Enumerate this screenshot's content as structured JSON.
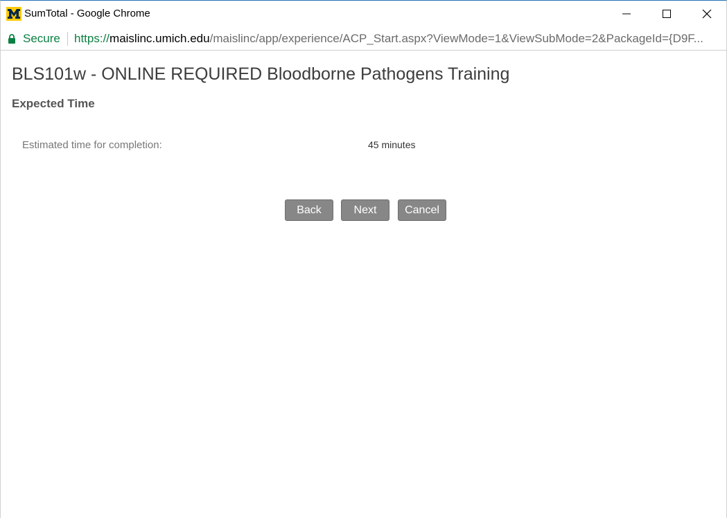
{
  "window": {
    "title": "SumTotal - Google Chrome"
  },
  "addressbar": {
    "secure_label": "Secure",
    "url_scheme": "https://",
    "url_host": "maislinc.umich.edu",
    "url_path": "/maislinc/app/experience/ACP_Start.aspx?ViewMode=1&ViewSubMode=2&PackageId={D9F..."
  },
  "page": {
    "course_title": "BLS101w - ONLINE REQUIRED Bloodborne Pathogens Training",
    "section_heading": "Expected Time",
    "estimated_label": "Estimated time for completion:",
    "estimated_value": "45 minutes"
  },
  "buttons": {
    "back": "Back",
    "next": "Next",
    "cancel": "Cancel"
  },
  "colors": {
    "secure_green": "#0b8043",
    "button_gray": "#878787",
    "logo_maize": "#ffcb05",
    "logo_blue": "#00274c"
  },
  "icons": {
    "logo": "university-of-michigan-block-m-icon",
    "lock": "lock-icon",
    "minimize": "minimize-icon",
    "maximize": "maximize-icon",
    "close": "close-icon"
  }
}
